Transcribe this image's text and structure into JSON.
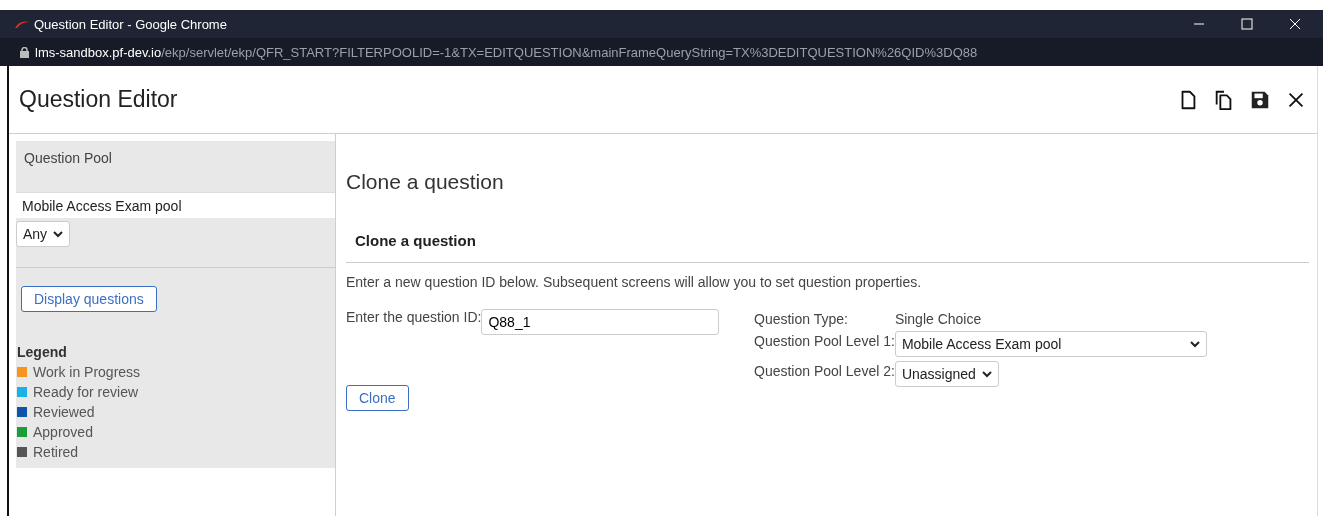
{
  "window": {
    "title": "Question Editor - Google Chrome"
  },
  "address_bar": {
    "host": "lms-sandbox.pf-dev.io",
    "path": "/ekp/servlet/ekp/QFR_START?FILTERPOOLID=-1&TX=EDITQUESTION&mainFrameQueryString=TX%3DEDITQUESTION%26QID%3DQ88"
  },
  "header": {
    "title": "Question Editor"
  },
  "sidebar": {
    "pool_label": "Question Pool",
    "pool_value": "Mobile Access Exam pool",
    "level_select": "Any",
    "display_button": "Display questions",
    "legend_title": "Legend",
    "legend": [
      {
        "label": "Work in Progress",
        "color": "#f7941d"
      },
      {
        "label": "Ready for review",
        "color": "#1ab0e8"
      },
      {
        "label": "Reviewed",
        "color": "#0b56a8"
      },
      {
        "label": "Approved",
        "color": "#1a9e3a"
      },
      {
        "label": "Retired",
        "color": "#555555"
      }
    ]
  },
  "main": {
    "page_title": "Clone a question",
    "section_title": "Clone a question",
    "instructions": "Enter a new question ID below. Subsequent screens will allow you to set question properties.",
    "id_label": "Enter the question ID:",
    "id_value": "Q88_1",
    "type_label": "Question Type:",
    "type_value": "Single Choice",
    "level1_label": "Question Pool Level 1:",
    "level1_value": "Mobile Access Exam pool",
    "level2_label": "Question Pool Level 2:",
    "level2_value": "Unassigned",
    "clone_button": "Clone"
  }
}
